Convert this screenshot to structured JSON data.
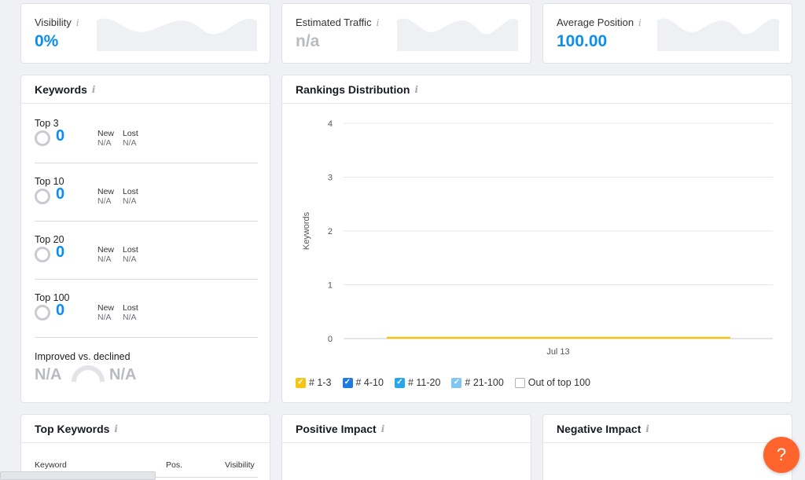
{
  "metrics": {
    "visibility": {
      "label": "Visibility",
      "value": "0%",
      "color": "#0a8ef0"
    },
    "traffic": {
      "label": "Estimated Traffic",
      "value": "n/a",
      "color": "#b9bbc1"
    },
    "position": {
      "label": "Average Position",
      "value": "100.00",
      "color": "#0a8ef0"
    }
  },
  "keywords": {
    "title": "Keywords",
    "rows": [
      {
        "name": "Top 3",
        "count": "0",
        "new_label": "New",
        "new_value": "N/A",
        "lost_label": "Lost",
        "lost_value": "N/A"
      },
      {
        "name": "Top 10",
        "count": "0",
        "new_label": "New",
        "new_value": "N/A",
        "lost_label": "Lost",
        "lost_value": "N/A"
      },
      {
        "name": "Top 20",
        "count": "0",
        "new_label": "New",
        "new_value": "N/A",
        "lost_label": "Lost",
        "lost_value": "N/A"
      },
      {
        "name": "Top 100",
        "count": "0",
        "new_label": "New",
        "new_value": "N/A",
        "lost_label": "Lost",
        "lost_value": "N/A"
      }
    ],
    "improved_label": "Improved vs. declined",
    "improved_value": "N/A",
    "declined_value": "N/A"
  },
  "rankings": {
    "title": "Rankings Distribution",
    "legend": [
      {
        "label": "# 1-3",
        "color": "#f5c414",
        "checked": true
      },
      {
        "label": "# 4-10",
        "color": "#1f7ae0",
        "checked": true
      },
      {
        "label": "# 11-20",
        "color": "#27a7e8",
        "checked": true
      },
      {
        "label": "# 21-100",
        "color": "#7fc6f0",
        "checked": true
      },
      {
        "label": "Out of top 100",
        "color": "#ffffff",
        "checked": false
      }
    ]
  },
  "chart_data": {
    "type": "line",
    "title": "",
    "xlabel": "",
    "ylabel": "Keywords",
    "x": [
      "Jul 13"
    ],
    "yticks": [
      0,
      1,
      2,
      3,
      4
    ],
    "ylim": [
      0,
      4
    ],
    "grid": true,
    "legend_position": "bottom",
    "series": [
      {
        "name": "# 1-3",
        "color": "#f5c414",
        "values": [
          0
        ]
      }
    ]
  },
  "top_keywords": {
    "title": "Top Keywords",
    "columns": [
      "Keyword",
      "Pos.",
      "Visibility"
    ]
  },
  "positive_impact": {
    "title": "Positive Impact"
  },
  "negative_impact": {
    "title": "Negative Impact"
  },
  "help": {
    "label": "?"
  },
  "icons": {
    "info": "info-icon",
    "help": "help-icon"
  }
}
